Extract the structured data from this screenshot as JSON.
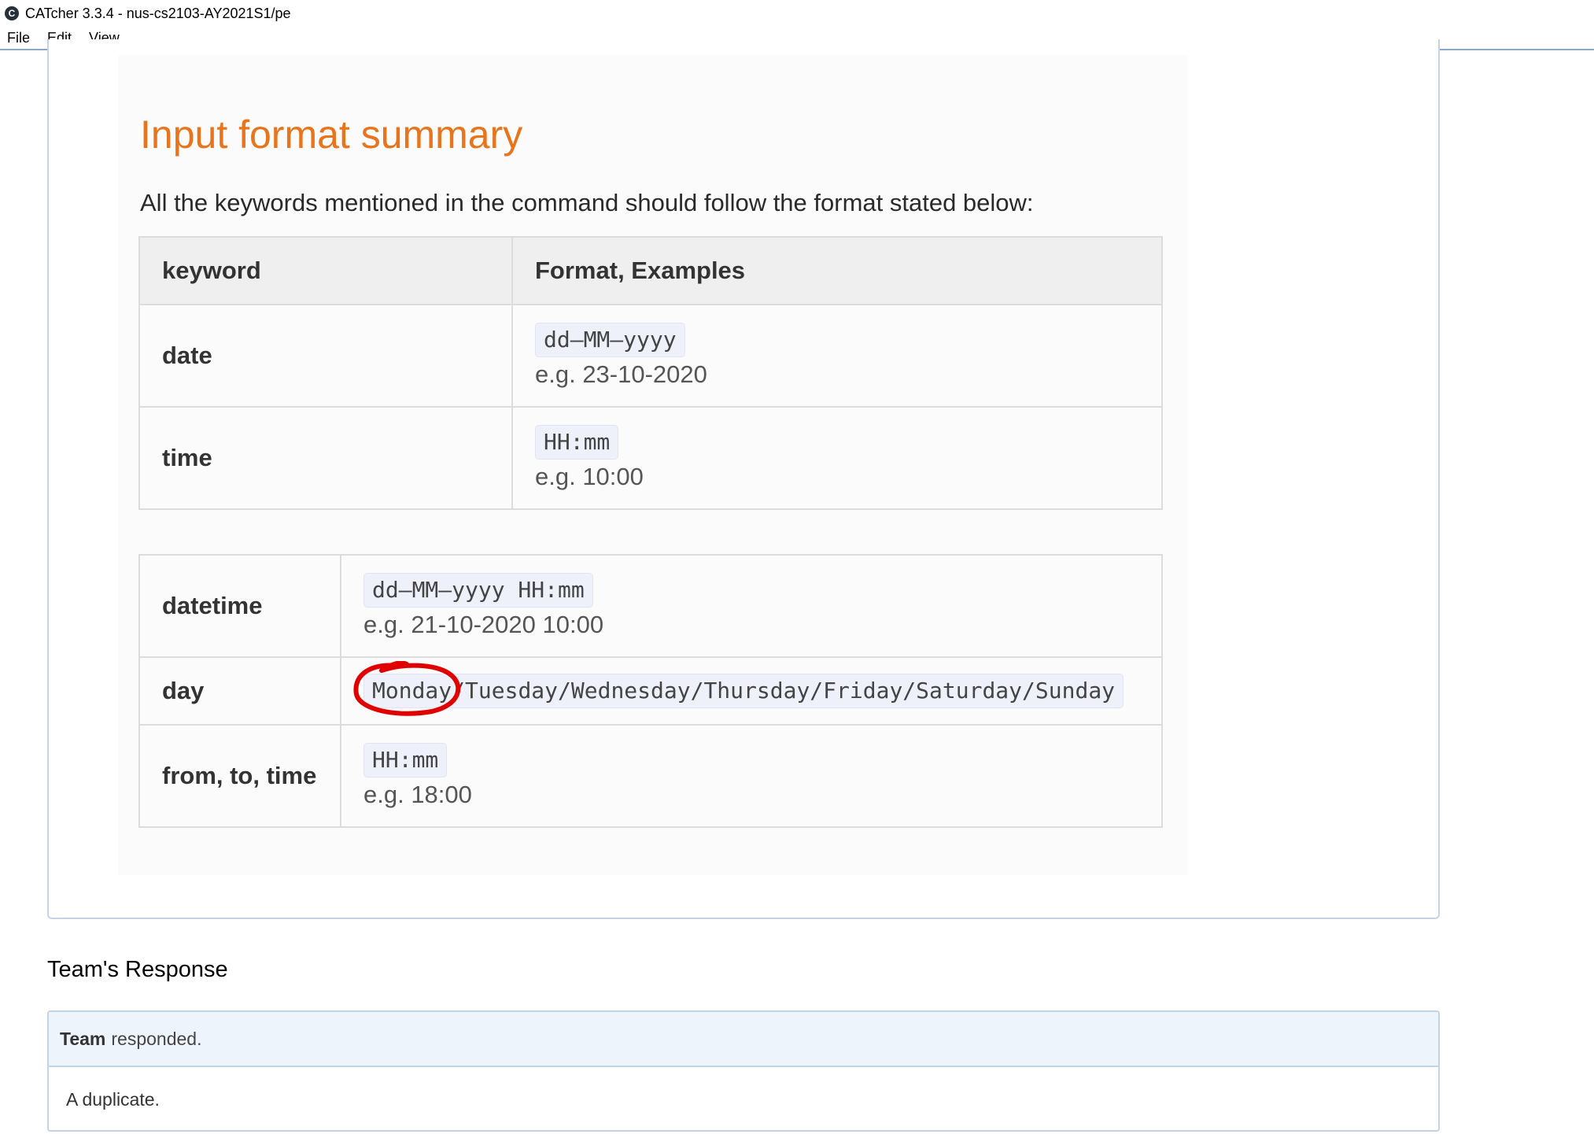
{
  "window": {
    "title": "CATcher 3.3.4 - nus-cs2103-AY2021S1/pe",
    "app_icon": "C"
  },
  "menu": [
    "File",
    "Edit",
    "View"
  ],
  "screenshot": {
    "heading": "Input format summary",
    "intro": "All the keywords mentioned in the command should follow the format stated below:",
    "table1": {
      "headers": [
        "keyword",
        "Format, Examples"
      ],
      "rows": [
        {
          "keyword": "date",
          "format": "dd–MM–yyyy",
          "example": "e.g. 23-10-2020"
        },
        {
          "keyword": "time",
          "format": "HH:mm",
          "example": "e.g. 10:00"
        }
      ]
    },
    "table2": {
      "rows": [
        {
          "keyword": "datetime",
          "format": "dd–MM–yyyy HH:mm",
          "example": "e.g. 21-10-2020 10:00"
        },
        {
          "keyword": "day",
          "format_first": "Monday",
          "format_rest": "/Tuesday/Wednesday/Thursday/Friday/Saturday/Sunday"
        },
        {
          "keyword": "from, to, time",
          "format": "HH:mm",
          "example": "e.g. 18:00"
        }
      ]
    },
    "annotation_color": "#e00000"
  },
  "response": {
    "heading": "Team's Response",
    "author": "Team",
    "action": "responded.",
    "body": "A duplicate."
  }
}
